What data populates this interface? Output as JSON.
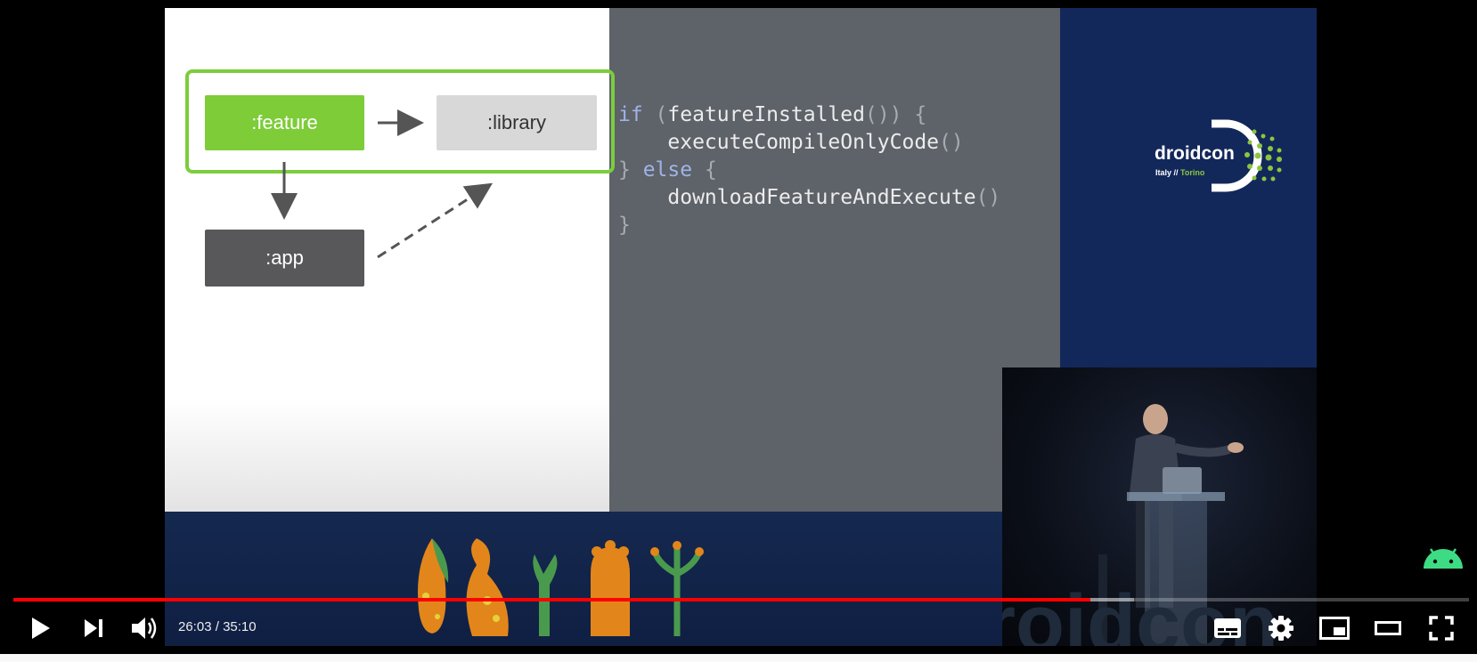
{
  "player": {
    "current_time": "26:03",
    "separator": " / ",
    "duration": "35:10",
    "progress_fraction": 0.74,
    "buffered_fraction": 0.77,
    "accent_color": "#ff0000"
  },
  "slide": {
    "nodes": {
      "feature": ":feature",
      "library": ":library",
      "app": ":app"
    },
    "code": {
      "line1_kw": "if",
      "line1_open": " (",
      "line1_fn": "featureInstalled",
      "line1_close": "()) {",
      "line2": "    executeCompileOnlyCode",
      "line2_parens": "()",
      "line3_brace": "} ",
      "line3_kw": "else",
      "line3_open": " {",
      "line4": "    downloadFeatureAndExecute",
      "line4_parens": "()",
      "line5": "}"
    }
  },
  "brand": {
    "name": "droidcon",
    "country": "Italy // ",
    "city": "Torino"
  },
  "icons": {
    "play": "play-icon",
    "next": "next-icon",
    "volume": "volume-icon",
    "subtitles": "subtitles-icon",
    "settings": "gear-icon",
    "miniplayer": "miniplayer-icon",
    "theater": "theater-icon",
    "fullscreen": "fullscreen-icon",
    "android": "android-icon"
  }
}
